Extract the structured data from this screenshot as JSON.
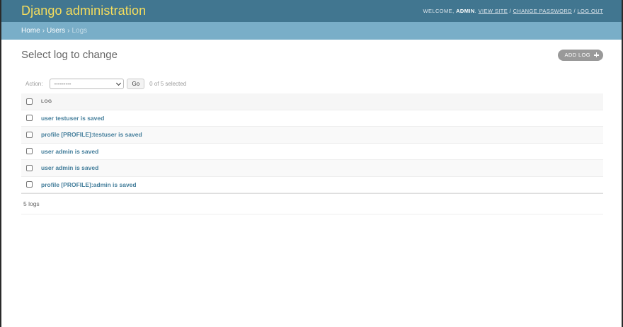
{
  "header": {
    "branding": "Django administration",
    "welcome": "WELCOME,",
    "username": "ADMIN",
    "links": [
      "VIEW SITE",
      "CHANGE PASSWORD",
      "LOG OUT"
    ],
    "separator": "/"
  },
  "breadcrumbs": [
    "Home",
    "Users",
    "Logs"
  ],
  "breadcrumb_separator": "›",
  "content": {
    "title": "Select log to change",
    "add_button": "ADD LOG",
    "action_label": "Action:",
    "action_selected": "---------",
    "go_button": "Go",
    "selection_counter": "0 of 5 selected",
    "column_header": "LOG",
    "rows": [
      "user testuser is saved",
      "profile [PROFILE]:testuser is saved",
      "user admin is saved",
      "user admin is saved",
      "profile [PROFILE]:admin is saved"
    ],
    "result_count": "5 logs"
  },
  "colors": {
    "header_bg": "#417690",
    "branding": "#f5dd5d",
    "breadcrumbs_bg": "#79aec8",
    "link": "#447e9b",
    "add_button_bg": "#999999"
  },
  "icons": {
    "add": "plus-icon",
    "select": "chevron-down-icon",
    "checkbox": "checkbox"
  }
}
